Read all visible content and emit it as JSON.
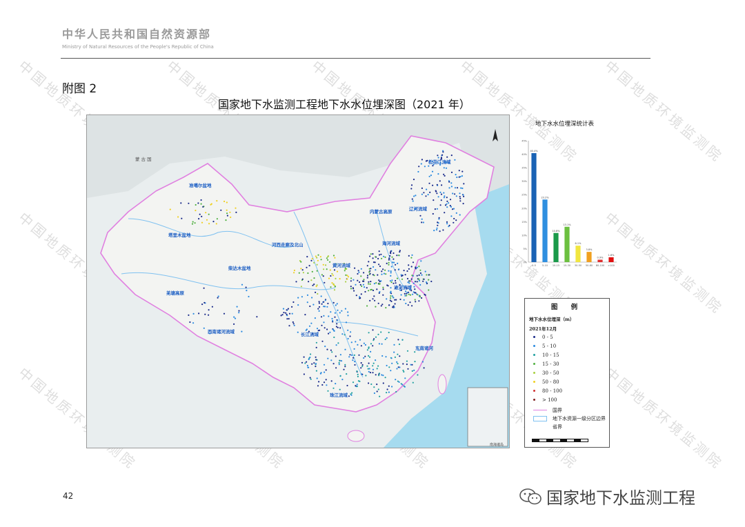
{
  "header": {
    "org_cn": "中华人民共和国自然资源部",
    "org_en": "Ministry of Natural Resources of the People's Republic of China"
  },
  "appendix_label": "附图 2",
  "map_title": "国家地下水监测工程地下水水位埋深图（2021 年）",
  "map": {
    "country_label": "蒙 古 国",
    "basins": [
      "松花江流域",
      "辽河流域",
      "内蒙古高原",
      "准噶尔盆地",
      "塔里木盆地",
      "河西走廊及北山",
      "海河流域",
      "黄河流域",
      "柴达木盆地",
      "羌塘高原",
      "淮河流域",
      "西南诸河流域",
      "长江流域",
      "东南诸河",
      "珠江流域"
    ],
    "small_note": "南海诸岛"
  },
  "stats": {
    "title": "地下水水位埋深统计表"
  },
  "chart_data": {
    "type": "bar",
    "title": "地下水水位埋深统计表",
    "categories": [
      "0-5",
      "5-10",
      "10-15",
      "15-30",
      "30-50",
      "50-80",
      "80-100",
      ">100"
    ],
    "values": [
      40.4,
      23.2,
      10.8,
      13.1,
      6.1,
      3.8,
      0.9,
      1.8
    ],
    "value_labels": [
      "40.4%",
      "23.2%",
      "10.8%",
      "13.1%",
      "6.1%",
      "3.8%",
      "0.9%",
      "1.8%"
    ],
    "bar_colors": [
      "#1a63b5",
      "#2f8fe0",
      "#1a9a4a",
      "#6cc040",
      "#f1e640",
      "#f0a020",
      "#e03030",
      "#e01010"
    ],
    "ylim": [
      0,
      45
    ],
    "yticks": [
      "0%",
      "5%",
      "10%",
      "15%",
      "20%",
      "25%",
      "30%",
      "35%",
      "40%",
      "45%"
    ],
    "grid": false
  },
  "legend": {
    "heading": "图 例",
    "subtitle": "地下水水位埋深（m）",
    "year": "2021年12月",
    "items": [
      {
        "label": "0 - 5",
        "color": "#1a2a8a"
      },
      {
        "label": "5 - 10",
        "color": "#2a8ae0"
      },
      {
        "label": "10 - 15",
        "color": "#20a0a0"
      },
      {
        "label": "15 - 30",
        "color": "#50b040"
      },
      {
        "label": "30 - 50",
        "color": "#a8d040"
      },
      {
        "label": "50 - 80",
        "color": "#f0d020"
      },
      {
        "label": "80 - 100",
        "color": "#d03030"
      },
      {
        "label": "> 100",
        "color": "#802020"
      }
    ],
    "border_national": "国界",
    "border_basin": "地下水资源一级分区边界",
    "border_province": "省界",
    "border_national_color": "#e080e0",
    "border_basin_color": "#7fc1f0"
  },
  "page_number": "42",
  "brand_text": "国家地下水监测工程",
  "watermark_text": "中国地质环境监测院"
}
